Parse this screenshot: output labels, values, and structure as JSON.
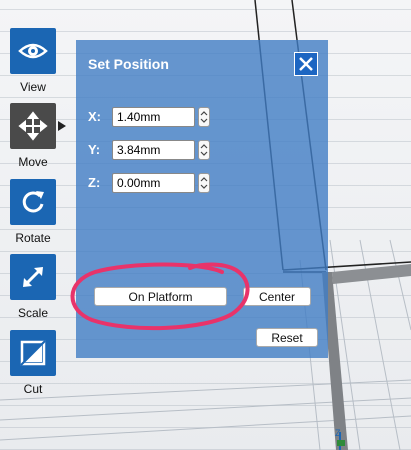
{
  "toolbar": {
    "items": [
      {
        "label": "View",
        "icon": "eye-icon",
        "active": false
      },
      {
        "label": "Move",
        "icon": "move-arrows-icon",
        "active": true
      },
      {
        "label": "Rotate",
        "icon": "rotate-icon",
        "active": false
      },
      {
        "label": "Scale",
        "icon": "scale-icon",
        "active": false
      },
      {
        "label": "Cut",
        "icon": "cut-icon",
        "active": false
      }
    ]
  },
  "panel": {
    "title": "Set Position",
    "fields": [
      {
        "axis": "X:",
        "value": "1.40mm"
      },
      {
        "axis": "Y:",
        "value": "3.84mm"
      },
      {
        "axis": "Z:",
        "value": "0.00mm"
      }
    ],
    "buttons": {
      "on_platform": "On Platform",
      "center": "Center",
      "reset": "Reset"
    }
  },
  "axis_indicator": {
    "label": "Z"
  },
  "colors": {
    "accent": "#1b66b3",
    "panel": "#417dc4",
    "annotation": "#e8336a"
  }
}
